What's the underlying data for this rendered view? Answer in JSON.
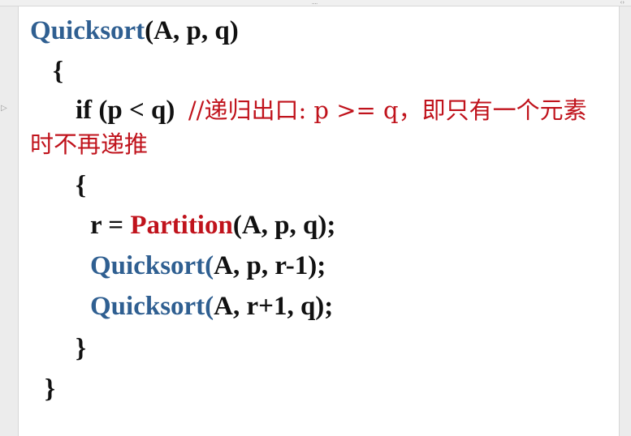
{
  "window": {
    "grip": "....",
    "resize_icon": "resize-horizontal-icon",
    "marker_icon": "slide-marker-icon"
  },
  "code": {
    "line1": {
      "fn": "Quicksort",
      "args": "(A, p, q)"
    },
    "line2": "{",
    "line3": {
      "kw": "if (p < q)",
      "comment": "//递归出口: p >= q，即只有一个元素"
    },
    "line4": "时不再递推",
    "line5": "{",
    "line6": {
      "lhs": "r = ",
      "fn": "Partition",
      "args": "(A, p, q);"
    },
    "line7": {
      "fn": "Quicksort(",
      "args": "A, p, r-1);"
    },
    "line8": {
      "fn": "Quicksort(",
      "args": "A, r+1, q);"
    },
    "line9": "}",
    "line10": "}"
  },
  "colors": {
    "function_blue": "#2f5f91",
    "highlight_red": "#c0131c",
    "text_black": "#111111",
    "slide_bg": "#ffffff"
  }
}
